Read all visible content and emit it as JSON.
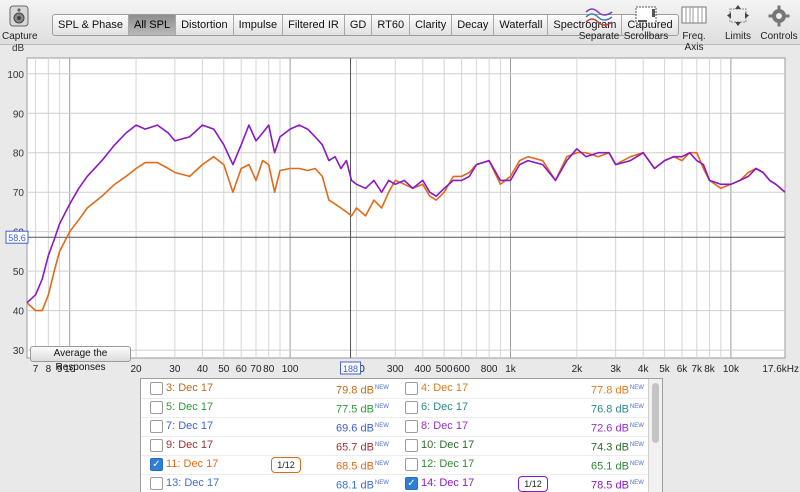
{
  "toolbar": {
    "capture_label": "Capture",
    "tabs": [
      "SPL & Phase",
      "All SPL",
      "Distortion",
      "Impulse",
      "Filtered IR",
      "GD",
      "RT60",
      "Clarity",
      "Decay",
      "Waterfall",
      "Spectrogram",
      "Captured"
    ],
    "active_tab": "All SPL",
    "right_buttons": [
      "Separate",
      "Scrollbars",
      "Freq. Axis",
      "Limits",
      "Controls"
    ]
  },
  "chart_data": {
    "type": "line",
    "ylabel": "dB",
    "ylim": [
      28,
      104
    ],
    "xlim": [
      6.4,
      17600
    ],
    "x_scale": "log",
    "y_ticks": [
      30,
      40,
      50,
      60,
      70,
      80,
      90,
      100
    ],
    "x_ticks": [
      "7",
      "8",
      "9",
      "10",
      "20",
      "30",
      "40",
      "50",
      "60",
      "70",
      "80",
      "100",
      "200",
      "300",
      "400",
      "500",
      "600",
      "800",
      "1k",
      "2k",
      "3k",
      "4k",
      "5k",
      "6k",
      "7k",
      "8k",
      "10k",
      "17.6kHz"
    ],
    "cursor_y_label": "58.6",
    "cursor_y_value": 58.6,
    "cursor_x_label": "188",
    "cursor_x_value": 188,
    "series": [
      {
        "name": "11: Dec 17",
        "color": "#e06a1a",
        "x": [
          6.4,
          7,
          7.5,
          8,
          8.5,
          9,
          10,
          11,
          12,
          14,
          16,
          18,
          20,
          22,
          25,
          28,
          30,
          35,
          40,
          45,
          50,
          55,
          60,
          65,
          70,
          75,
          80,
          85,
          90,
          100,
          110,
          120,
          130,
          140,
          150,
          160,
          170,
          180,
          190,
          200,
          220,
          240,
          260,
          280,
          300,
          330,
          360,
          400,
          430,
          460,
          500,
          550,
          600,
          650,
          700,
          800,
          900,
          1000,
          1100,
          1200,
          1400,
          1600,
          1800,
          2000,
          2200,
          2500,
          2800,
          3000,
          3500,
          4000,
          4500,
          5000,
          5500,
          6000,
          6500,
          7000,
          7500,
          8000,
          9000,
          10000,
          11000,
          12000,
          13000,
          14000,
          15000,
          16000,
          17600
        ],
        "y": [
          42,
          40,
          40,
          44,
          50,
          55,
          60,
          63,
          66,
          69,
          72,
          74,
          76,
          77.5,
          77.5,
          76,
          75,
          74,
          77,
          79,
          77,
          70,
          76,
          77,
          73,
          78,
          77,
          70,
          75.5,
          76,
          76,
          75.5,
          76,
          74,
          68,
          67,
          66,
          65,
          64,
          66,
          64,
          68,
          66,
          70,
          73,
          72,
          71,
          72,
          69,
          68,
          70,
          74,
          74,
          75,
          77,
          78,
          72,
          74,
          78,
          79,
          78,
          73,
          79,
          80,
          80,
          79,
          80,
          77,
          79,
          80,
          76,
          78,
          79,
          78,
          80,
          80,
          76,
          73,
          71,
          72,
          73,
          75,
          76,
          75,
          73,
          72,
          70
        ]
      },
      {
        "name": "14: Dec 17",
        "color": "#8a18c4",
        "x": [
          6.4,
          7,
          7.5,
          8,
          8.5,
          9,
          10,
          11,
          12,
          14,
          16,
          18,
          20,
          22,
          25,
          28,
          30,
          35,
          40,
          45,
          50,
          55,
          60,
          65,
          70,
          75,
          80,
          85,
          90,
          100,
          110,
          120,
          130,
          140,
          150,
          160,
          170,
          180,
          190,
          200,
          220,
          240,
          260,
          280,
          300,
          330,
          360,
          400,
          430,
          460,
          500,
          550,
          600,
          650,
          700,
          800,
          900,
          1000,
          1100,
          1200,
          1400,
          1600,
          1800,
          2000,
          2200,
          2500,
          2800,
          3000,
          3500,
          4000,
          4500,
          5000,
          5500,
          6000,
          6500,
          7000,
          7500,
          8000,
          9000,
          10000,
          11000,
          12000,
          13000,
          14000,
          15000,
          16000,
          17600
        ],
        "y": [
          42,
          44,
          48,
          54,
          58,
          62,
          67,
          71,
          74,
          78,
          82,
          85,
          87,
          86,
          87,
          85,
          83,
          84,
          87,
          86,
          82,
          77,
          82,
          87,
          83,
          85,
          87,
          80,
          84,
          86,
          87,
          86,
          84,
          82,
          78,
          79,
          76,
          78,
          73,
          72,
          71,
          73,
          70,
          73,
          72,
          73,
          71,
          73,
          70,
          69,
          71,
          73,
          73,
          74,
          77,
          78,
          73,
          73,
          77,
          78,
          77,
          73,
          78,
          81,
          79,
          80,
          80,
          77,
          78,
          80,
          76,
          78,
          79,
          79,
          80,
          78,
          77,
          73,
          72,
          72,
          73,
          74,
          76,
          75,
          73,
          72,
          70
        ]
      }
    ]
  },
  "chart_overlay": {
    "average_button_label": "Average the Responses"
  },
  "legend": {
    "rows": [
      {
        "left": {
          "name": "3: Dec 17",
          "value": "79.8 dB",
          "new": "NEW",
          "checked": false,
          "color": "#c06a1a",
          "smoothing": ""
        },
        "right": {
          "name": "4: Dec 17",
          "value": "77.8 dB",
          "new": "NEW",
          "checked": false,
          "color": "#e07a20",
          "smoothing": ""
        }
      },
      {
        "left": {
          "name": "5: Dec 17",
          "value": "77.5 dB",
          "new": "NEW",
          "checked": false,
          "color": "#2e9a38",
          "smoothing": ""
        },
        "right": {
          "name": "6: Dec 17",
          "value": "76.8 dB",
          "new": "NEW",
          "checked": false,
          "color": "#2b8a8a",
          "smoothing": ""
        }
      },
      {
        "left": {
          "name": "7: Dec 17",
          "value": "69.6 dB",
          "new": "NEW",
          "checked": false,
          "color": "#3d5fd0",
          "smoothing": ""
        },
        "right": {
          "name": "8: Dec 17",
          "value": "72.6 dB",
          "new": "NEW",
          "checked": false,
          "color": "#9a2ec8",
          "smoothing": ""
        }
      },
      {
        "left": {
          "name": "9: Dec 17",
          "value": "65.7 dB",
          "new": "NEW",
          "checked": false,
          "color": "#a03030",
          "smoothing": ""
        },
        "right": {
          "name": "10: Dec 17",
          "value": "74.3 dB",
          "new": "NEW",
          "checked": false,
          "color": "#2a6a2a",
          "smoothing": ""
        }
      },
      {
        "left": {
          "name": "11: Dec 17",
          "value": "68.5 dB",
          "new": "NEW",
          "checked": true,
          "color": "#e06a1a",
          "smoothing": "1/12"
        },
        "right": {
          "name": "12: Dec 17",
          "value": "65.1 dB",
          "new": "NEW",
          "checked": false,
          "color": "#2e8a38",
          "smoothing": ""
        }
      },
      {
        "left": {
          "name": "13: Dec 17",
          "value": "68.1 dB",
          "new": "NEW",
          "checked": false,
          "color": "#3d6fd0",
          "smoothing": ""
        },
        "right": {
          "name": "14: Dec 17",
          "value": "78.5 dB",
          "new": "NEW",
          "checked": true,
          "color": "#8a18c4",
          "smoothing": "1/12"
        }
      }
    ]
  }
}
